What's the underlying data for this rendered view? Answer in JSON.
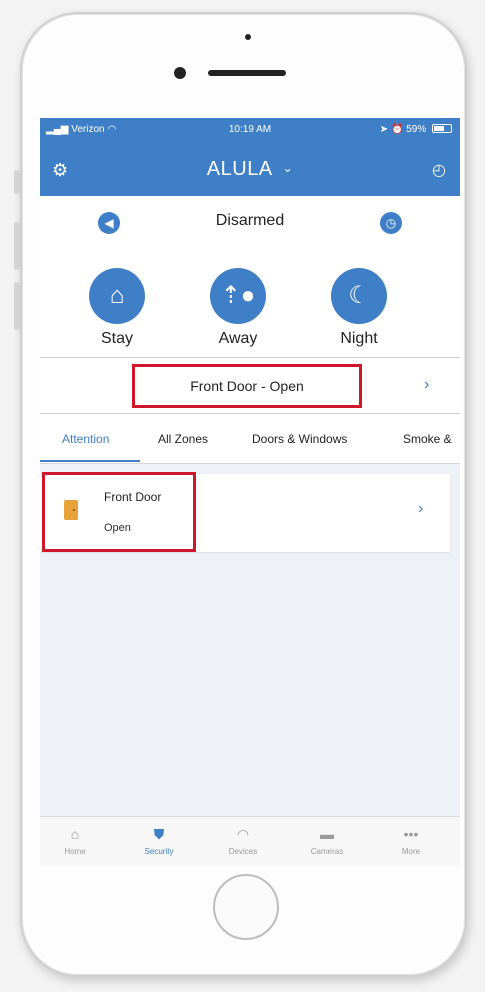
{
  "status_bar": {
    "carrier": "Verizon",
    "time": "10:19 AM",
    "battery": "59%"
  },
  "header": {
    "title": "ALULA"
  },
  "arm_panel": {
    "status": "Disarmed",
    "modes": [
      {
        "label": "Stay",
        "icon": "home-icon"
      },
      {
        "label": "Away",
        "icon": "people-icon"
      },
      {
        "label": "Night",
        "icon": "moon-icon"
      }
    ]
  },
  "alert": {
    "text": "Front Door - Open"
  },
  "tabs": [
    {
      "label": "Attention",
      "active": true
    },
    {
      "label": "All Zones"
    },
    {
      "label": "Doors & Windows"
    },
    {
      "label": "Smoke &"
    }
  ],
  "zones": [
    {
      "name": "Front Door",
      "state": "Open",
      "icon": "door-icon"
    }
  ],
  "tabbar": [
    {
      "label": "Home",
      "icon": "home-icon"
    },
    {
      "label": "Security",
      "icon": "shield-icon",
      "active": true
    },
    {
      "label": "Devices",
      "icon": "wifi-icon"
    },
    {
      "label": "Cameras",
      "icon": "camera-icon"
    },
    {
      "label": "More",
      "icon": "more-icon"
    }
  ],
  "colors": {
    "primary": "#3f7fc8",
    "highlight": "#d0162a",
    "door": "#e9a23a"
  }
}
